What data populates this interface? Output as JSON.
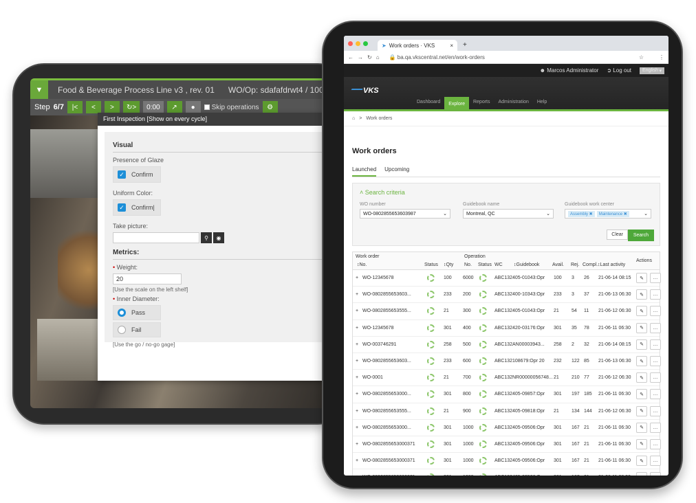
{
  "back_tablet": {
    "title": "Food & Beverage Process Line v3 , rev. 01",
    "wo_op": "WO/Op: sdafafdrwt4 / 100",
    "step_label": "Step",
    "step_value": "6/7",
    "timer": "0:00",
    "skip_label": "Skip operations",
    "dialog": {
      "header": "First Inspection [Show on every cycle]",
      "visual_section": "Visual",
      "presence_label": "Presence of Glaze",
      "presence_confirm": "Confirm",
      "uniform_label": "Uniform Color:",
      "uniform_confirm": "Confirm|",
      "picture_label": "Take picture:",
      "metrics_section": "Metrics:",
      "weight_label": "Weight:",
      "weight_value": "20",
      "weight_hint": "[Use the scale on the left shelf]",
      "diameter_label": "Inner Diameter:",
      "pass_label": "Pass",
      "fail_label": "Fail",
      "diameter_hint": "[Use the go / no-go gage]"
    }
  },
  "browser": {
    "tab_title": "Work orders · VKS",
    "url": "ba.qa.vkscentral.net/en/work-orders",
    "user": "Marcos Administrator",
    "logout": "Log out",
    "language": "English",
    "logo": "VKS",
    "menu": [
      "Dashboard",
      "Explore",
      "Reports",
      "Administration",
      "Help"
    ],
    "active_menu": "Explore",
    "breadcrumb": "Work orders",
    "page_title": "Work orders",
    "tabs": [
      "Launched",
      "Upcoming"
    ],
    "search": {
      "title": "Search criteria",
      "wo_label": "WO number",
      "wo_value": "WO-0802855653603987",
      "guidebook_label": "Guidebook name",
      "guidebook_value": "Montreal, QC",
      "center_label": "Guidebook work center",
      "chips": [
        "Assembly ✖",
        "Maintenance ✖"
      ],
      "clear": "Clear",
      "search": "Search"
    },
    "table": {
      "group_work_order": "Work order",
      "group_operation": "Operation",
      "headers": [
        "No.",
        "Status",
        "Qty",
        "No.",
        "Status",
        "WC",
        "Guidebook",
        "Avail.",
        "Rej.",
        "Compl.",
        "Last activity",
        "Actions"
      ],
      "rows": [
        {
          "no": "WO-12345678",
          "qty": "100",
          "op": "6000",
          "wc": "ABC132",
          "gb": "405-01043:Opr",
          "avail": "100",
          "rej": "3",
          "compl": "26",
          "last": "21-06-14 08:15"
        },
        {
          "no": "WO-0802855653603...",
          "qty": "233",
          "op": "200",
          "wc": "ABC132",
          "gb": "400-10343:Opr",
          "avail": "233",
          "rej": "3",
          "compl": "37",
          "last": "21-06-13 06:30"
        },
        {
          "no": "WO-0802855653555...",
          "qty": "21",
          "op": "300",
          "wc": "ABC132",
          "gb": "405-01043:Opr",
          "avail": "21",
          "rej": "54",
          "compl": "11",
          "last": "21-06-12 06:30"
        },
        {
          "no": "WO-12345678",
          "qty": "301",
          "op": "400",
          "wc": "ABC132",
          "gb": "420-03176:Opr",
          "avail": "301",
          "rej": "35",
          "compl": "78",
          "last": "21-06-11 06:30"
        },
        {
          "no": "WO-003746291",
          "qty": "258",
          "op": "500",
          "wc": "ABC132",
          "gb": "AN00003943...",
          "avail": "258",
          "rej": "2",
          "compl": "32",
          "last": "21-06-14 08:15"
        },
        {
          "no": "WO-0802855653603...",
          "qty": "233",
          "op": "600",
          "wc": "ABC132",
          "gb": "108679:Opr 20",
          "avail": "232",
          "rej": "122",
          "compl": "85",
          "last": "21-06-13 06:30"
        },
        {
          "no": "WO-0001",
          "qty": "21",
          "op": "700",
          "wc": "ABC132",
          "gb": "NR00000056748...",
          "avail": "21",
          "rej": "210",
          "compl": "77",
          "last": "21-06-12 06:30"
        },
        {
          "no": "WO-0802855653000...",
          "qty": "301",
          "op": "800",
          "wc": "ABC132",
          "gb": "405-09857:Opr",
          "avail": "301",
          "rej": "197",
          "compl": "185",
          "last": "21-06-11 06:30"
        },
        {
          "no": "WO-0802855653555...",
          "qty": "21",
          "op": "900",
          "wc": "ABC132",
          "gb": "405-09818:Opr",
          "avail": "21",
          "rej": "134",
          "compl": "144",
          "last": "21-06-12 06:30"
        },
        {
          "no": "WO-0802855653000...",
          "qty": "301",
          "op": "1000",
          "wc": "ABC132",
          "gb": "405-09506:Opr",
          "avail": "301",
          "rej": "167",
          "compl": "21",
          "last": "21-06-11 06:30"
        },
        {
          "no": "WO-0802855653000371",
          "qty": "301",
          "op": "1000",
          "wc": "ABC132",
          "gb": "405-09506:Opr",
          "avail": "301",
          "rej": "167",
          "compl": "21",
          "last": "21-06-11 06:30"
        },
        {
          "no": "WO-0802855653000371",
          "qty": "301",
          "op": "1000",
          "wc": "ABC132",
          "gb": "405-09506:Opr",
          "avail": "301",
          "rej": "167",
          "compl": "21",
          "last": "21-06-11 06:30"
        },
        {
          "no": "WO-0802855653000371",
          "qty": "301",
          "op": "1000",
          "wc": "ABC132",
          "gb": "405-09506:Opr",
          "avail": "301",
          "rej": "167",
          "compl": "21",
          "last": "21-06-11 06:30"
        }
      ]
    }
  },
  "colors": {
    "accent_green": "#6bb43f",
    "checkbox_blue": "#1d8fd8"
  }
}
